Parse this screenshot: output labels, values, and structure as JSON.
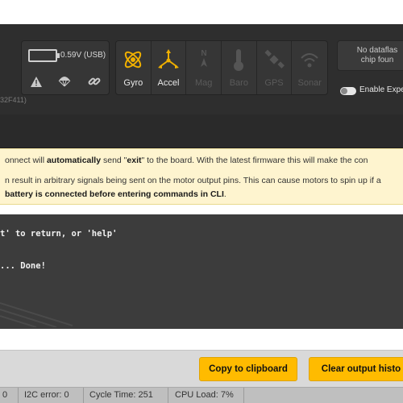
{
  "header": {
    "battery_text": "0.59V (USB)",
    "status_icons": [
      "warning-icon",
      "parachute-icon",
      "link-icon"
    ],
    "sensors": [
      {
        "label": "Gyro",
        "icon": "gyro-icon",
        "active": true
      },
      {
        "label": "Accel",
        "icon": "accel-icon",
        "active": true
      },
      {
        "label": "Mag",
        "icon": "mag-icon",
        "active": false
      },
      {
        "label": "Baro",
        "icon": "baro-icon",
        "active": false
      },
      {
        "label": "GPS",
        "icon": "gps-icon",
        "active": false
      },
      {
        "label": "Sonar",
        "icon": "sonar-icon",
        "active": false
      }
    ],
    "dataflash_line1": "No dataflas",
    "dataflash_line2": "chip foun",
    "expert_toggle_label": "Enable Expe",
    "board_id": "32F411)"
  },
  "notice": {
    "line1_pre": "onnect will ",
    "line1_bold1": "automatically",
    "line1_mid": " send \"",
    "line1_bold2": "exit",
    "line1_post": "\" to the board. With the latest firmware this will make the con",
    "line2": "n result in arbitrary signals being sent on the motor output pins. This can cause motors to spin up if a",
    "line3_bold": "battery is connected before entering commands in CLI",
    "line3_post": "."
  },
  "terminal": {
    "line1": "t' to return, or 'help'",
    "line2": "... Done!"
  },
  "buttons": {
    "copy": "Copy to clipboard",
    "clear": "Clear output histo"
  },
  "statusbar": {
    "seg0": "0",
    "i2c": "I2C error: 0",
    "cycle": "Cycle Time: 251",
    "cpu": "CPU Load: 7%"
  },
  "colors": {
    "accent": "#ffbb00",
    "sensor_active": "#f0b000",
    "sensor_inactive": "#555555",
    "notice_bg": "#fef4cf"
  }
}
